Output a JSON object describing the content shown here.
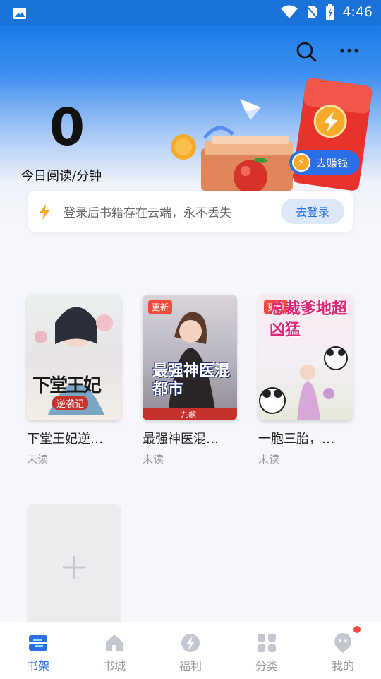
{
  "status_bar": {
    "time": "4:46"
  },
  "reading": {
    "count": "0",
    "label": "今日阅读/分钟"
  },
  "earn_button": {
    "label": "去赚钱"
  },
  "login_prompt": {
    "text": "登录后书籍存在云端，永不丢失",
    "button": "去登录"
  },
  "books": [
    {
      "title": "下堂王妃逆…",
      "status": "未读",
      "badge": "",
      "cover_text": "下堂王妃",
      "cover_sub": "逆袭记"
    },
    {
      "title": "最强神医混…",
      "status": "未读",
      "badge": "更新",
      "cover_text": "最强神医混都市",
      "cover_sub": "九歌"
    },
    {
      "title": "一胞三胎，…",
      "status": "未读",
      "badge": "更新",
      "cover_text": "总裁爹地超凶猛",
      "cover_sub": ""
    }
  ],
  "tabs": [
    {
      "label": "书架",
      "icon": "bookshelf-icon",
      "active": true
    },
    {
      "label": "书城",
      "icon": "home-icon",
      "active": false
    },
    {
      "label": "福利",
      "icon": "bolt-icon",
      "active": false
    },
    {
      "label": "分类",
      "icon": "grid-icon",
      "active": false
    },
    {
      "label": "我的",
      "icon": "profile-icon",
      "active": false,
      "dot": true
    }
  ],
  "colors": {
    "accent": "#2a6ee8",
    "header_blue": "#1a7be8",
    "badge_red": "#f04a3c"
  }
}
